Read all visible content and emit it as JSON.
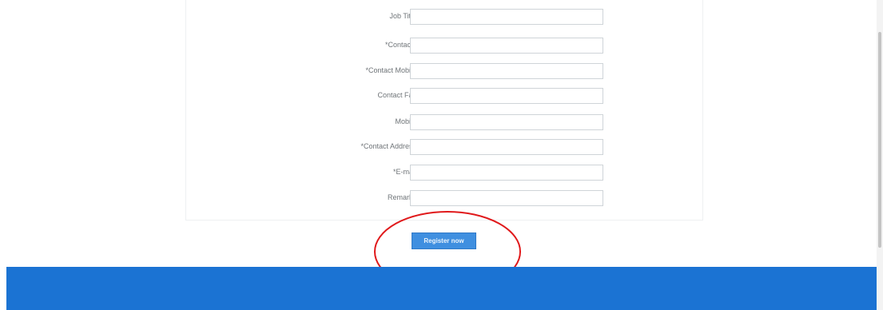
{
  "form": {
    "fields": [
      {
        "label": "Job Title",
        "value": ""
      },
      {
        "label": "*Contacts",
        "value": ""
      },
      {
        "label": "*Contact Mobile",
        "value": ""
      },
      {
        "label": "Contact Fax",
        "value": ""
      },
      {
        "label": "Mobile",
        "value": ""
      },
      {
        "label": "*Contact Address",
        "value": ""
      },
      {
        "label": "*E-mail",
        "value": ""
      },
      {
        "label": "Remarks",
        "value": ""
      }
    ]
  },
  "actions": {
    "register_label": "Register now"
  },
  "colors": {
    "primary_button": "#3f8fe0",
    "footer": "#1b73d3",
    "annotation": "#e0191b"
  }
}
